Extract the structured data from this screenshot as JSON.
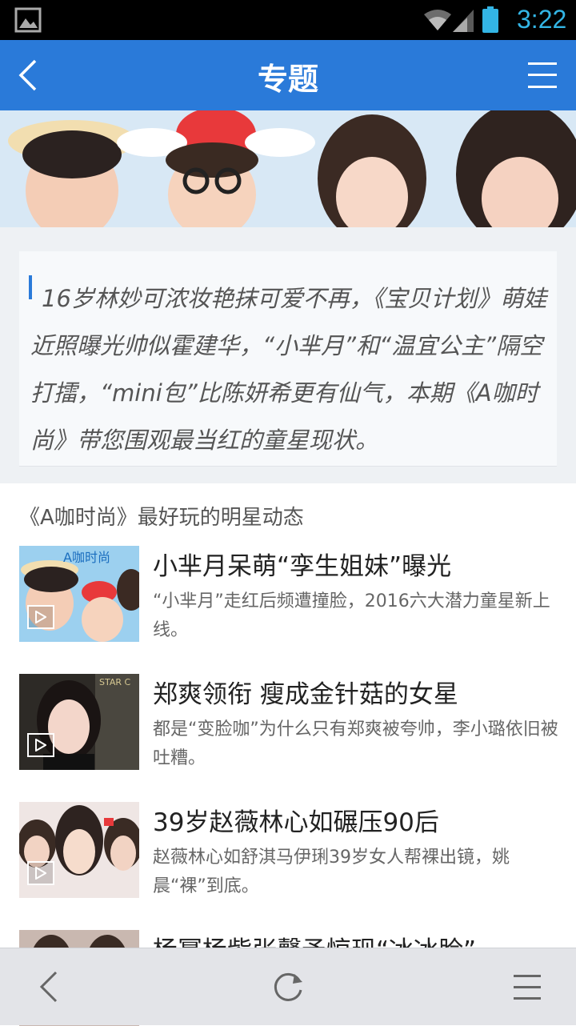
{
  "status_bar": {
    "time": "3:22",
    "icons": [
      "gallery-icon",
      "wifi-icon",
      "signal-icon",
      "battery-icon"
    ]
  },
  "header": {
    "title": "专题",
    "back_icon": "chevron-left-icon",
    "menu_icon": "menu-icon"
  },
  "summary": {
    "text": "16岁林妙可浓妆艳抹可爱不再，《宝贝计划》萌娃近照曝光帅似霍建华，“小芈月”和“温宜公主”隔空打擂，“mini包”比陈妍希更有仙气，本期《A咖时尚》带您围观最当红的童星现状。"
  },
  "section": {
    "title": "《A咖时尚》最好玩的明星动态"
  },
  "articles": [
    {
      "title": "小芈月呆萌“孪生姐妹”曝光",
      "desc": "“小芈月”走红后频遭撞脸，2016六大潜力童星新上线。",
      "icon": "play-icon"
    },
    {
      "title": "郑爽领衔 瘦成金针菇的女星",
      "desc": "都是“变脸咖”为什么只有郑爽被夸帅，李小璐依旧被吐糟。",
      "icon": "play-icon"
    },
    {
      "title": "39岁赵薇林心如碾压90后",
      "desc": "赵薇林心如舒淇马伊琍39岁女人帮裸出镜，姚晨“裸”到底。",
      "icon": "play-icon"
    },
    {
      "title": "杨幂杨紫张馨予惊现“冰冰脸”",
      "desc": "",
      "icon": "play-icon"
    }
  ],
  "bottom_bar": {
    "icons": [
      "back-icon",
      "refresh-icon",
      "menu-icon"
    ]
  },
  "colors": {
    "header_bg": "#2a7ad9",
    "status_time": "#33b5e5",
    "accent_bar": "#2a7ad9"
  }
}
